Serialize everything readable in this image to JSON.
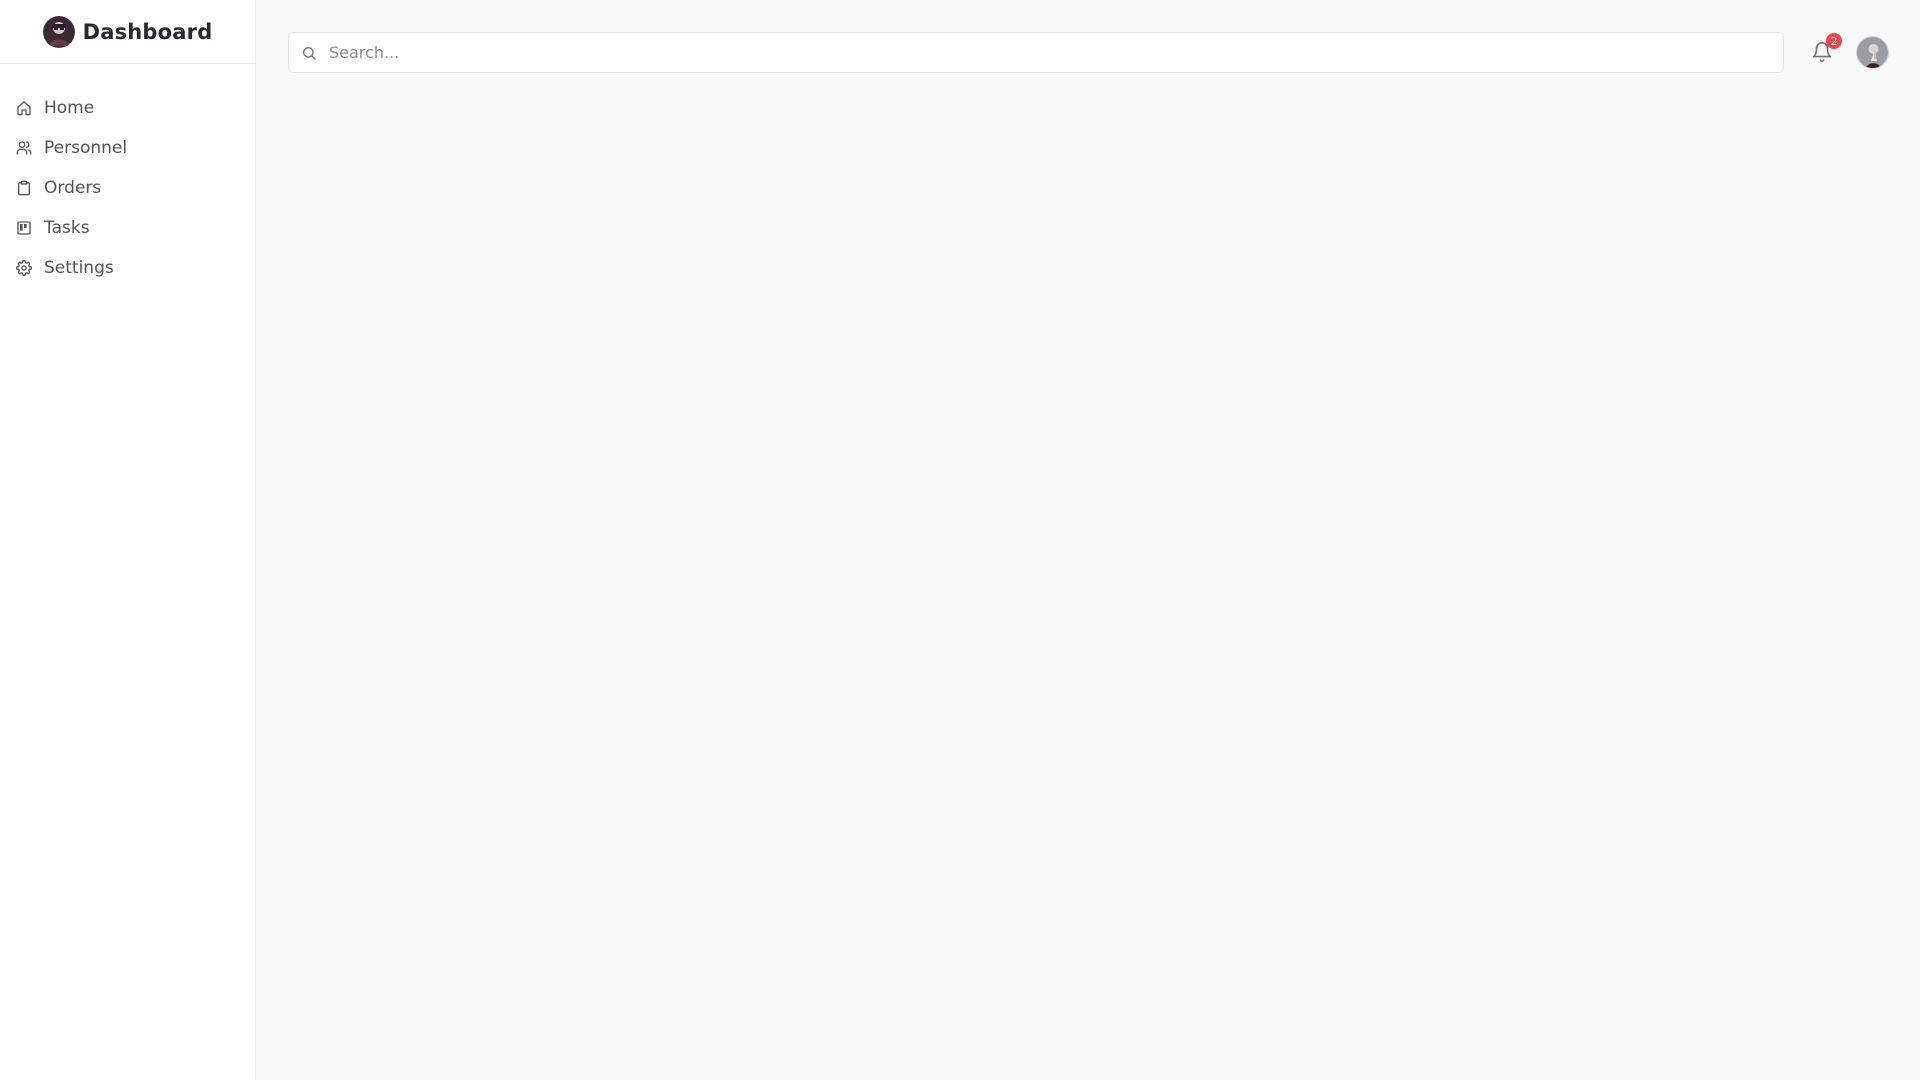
{
  "brand": {
    "title": "Dashboard",
    "logo_icon": "avatar-logo"
  },
  "sidebar": {
    "items": [
      {
        "label": "Home",
        "icon": "home-icon"
      },
      {
        "label": "Personnel",
        "icon": "users-icon"
      },
      {
        "label": "Orders",
        "icon": "clipboard-icon"
      },
      {
        "label": "Tasks",
        "icon": "kanban-icon"
      },
      {
        "label": "Settings",
        "icon": "gear-icon"
      }
    ]
  },
  "header": {
    "search": {
      "placeholder": "Search...",
      "value": ""
    },
    "notifications": {
      "count": "2",
      "badge_color": "#ef4444"
    }
  },
  "colors": {
    "sidebar_bg": "#ffffff",
    "main_bg": "#f8f9fb",
    "text": "#52525b"
  }
}
